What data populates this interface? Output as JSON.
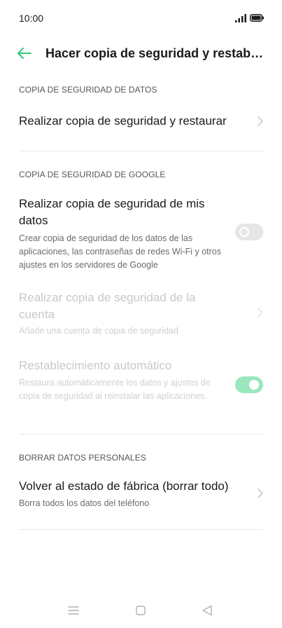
{
  "status_bar": {
    "time": "10:00"
  },
  "app_bar": {
    "title": "Hacer copia de seguridad y restablec..."
  },
  "sections": {
    "backup": {
      "header": "COPIA DE SEGURIDAD DE DATOS",
      "item_title": "Realizar copia de seguridad y restaurar"
    },
    "google": {
      "header": "COPIA DE SEGURIDAD DE GOOGLE",
      "my_data_title": "Realizar copia de seguridad de mis datos",
      "my_data_sub": "Crear copia de seguridad de los datos de las aplicaciones, las contraseñas de redes Wi-Fi y otros ajustes en los servidores de Google",
      "account_title": "Realizar copia de seguridad de la cuenta",
      "account_sub": "Añade una cuenta de copia de seguridad",
      "auto_restore_title": "Restablecimiento automático",
      "auto_restore_sub": "Restaura automáticamente los datos y ajustes de copia de seguridad al reinstalar las aplicaciones."
    },
    "erase": {
      "header": "BORRAR DATOS PERSONALES",
      "factory_title": "Volver al estado de fábrica (borrar todo)",
      "factory_sub": "Borra todos los datos del teléfono"
    }
  },
  "toggles": {
    "backup_my_data": false,
    "auto_restore": true
  },
  "colors": {
    "accent": "#2fc77a",
    "toggle_on": "#9be6bf",
    "toggle_off": "#e6e6e6"
  }
}
